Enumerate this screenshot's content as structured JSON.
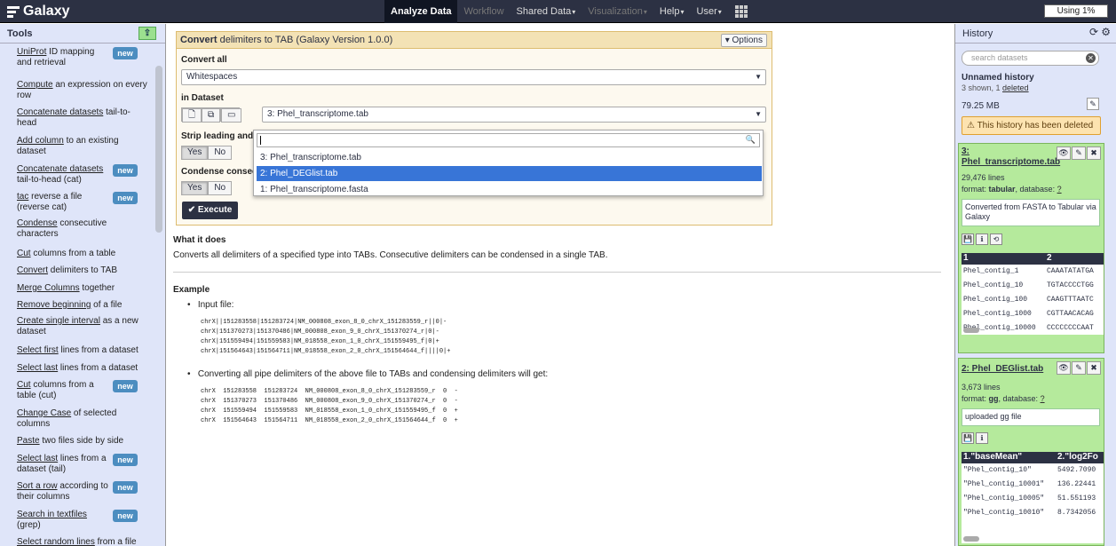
{
  "masthead": {
    "brand": "Galaxy",
    "nav": [
      {
        "label": "Analyze Data",
        "state": "active",
        "caret": ""
      },
      {
        "label": "Workflow",
        "state": "disabled",
        "caret": ""
      },
      {
        "label": "Shared Data",
        "state": "normal",
        "caret": "▾"
      },
      {
        "label": "Visualization",
        "state": "disabled",
        "caret": "▾"
      },
      {
        "label": "Help",
        "state": "normal",
        "caret": "▾"
      },
      {
        "label": "User",
        "state": "normal",
        "caret": "▾"
      }
    ],
    "quota": "Using 1%"
  },
  "tools_panel": {
    "title": "Tools",
    "upload_icon": "upload-icon",
    "tools": [
      {
        "link": "UniProt",
        "rest": " ID mapping and retrieval",
        "new": true
      },
      {
        "link": "Compute",
        "rest": " an expression on every row",
        "new": false
      },
      {
        "link": "Concatenate datasets",
        "rest": " tail-to-head",
        "new": false
      },
      {
        "link": "Add column",
        "rest": " to an existing dataset",
        "new": false
      },
      {
        "link": "Concatenate datasets",
        "rest": " tail-to-head (cat)",
        "new": true
      },
      {
        "link": "tac",
        "rest": " reverse a file (reverse cat)",
        "new": true
      },
      {
        "link": "Condense",
        "rest": " consecutive characters",
        "new": false
      },
      {
        "link": "Cut",
        "rest": " columns from a table",
        "new": false
      },
      {
        "link": "Convert",
        "rest": " delimiters to TAB",
        "new": false
      },
      {
        "link": "Merge Columns",
        "rest": " together",
        "new": false
      },
      {
        "link": "Remove beginning",
        "rest": " of a file",
        "new": false
      },
      {
        "link": "Create single interval",
        "rest": " as a new dataset",
        "new": false
      },
      {
        "link": "Select first",
        "rest": " lines from a dataset",
        "new": false
      },
      {
        "link": "Select last",
        "rest": " lines from a dataset",
        "new": false
      },
      {
        "link": "Cut",
        "rest": " columns from a table (cut)",
        "new": true
      },
      {
        "link": "Change Case",
        "rest": " of selected columns",
        "new": false
      },
      {
        "link": "Paste",
        "rest": " two files side by side",
        "new": false
      },
      {
        "link": "Select last",
        "rest": " lines from a dataset (tail)",
        "new": true
      },
      {
        "link": "Sort a row",
        "rest": " according to their columns",
        "new": true
      },
      {
        "link": "Search in textfiles",
        "rest": " (grep)",
        "new": true
      },
      {
        "link": "Select random lines",
        "rest": " from a file",
        "new": false
      }
    ],
    "new_label": "new"
  },
  "tool_form": {
    "title_bold": "Convert",
    "title_rest": " delimiters to TAB (Galaxy Version 1.0.0)",
    "options_label": "Options",
    "convert_all_label": "Convert all",
    "convert_all_value": "Whitespaces",
    "in_dataset_label": "in Dataset",
    "in_dataset_value": "3: Phel_transcriptome.tab",
    "strip_label": "Strip leading and",
    "condense_label": "Condense consec",
    "yes_label": "Yes",
    "no_label": "No",
    "execute_label": "Execute",
    "dropdown_options": [
      {
        "label": "3: Phel_transcriptome.tab",
        "selected": false
      },
      {
        "label": "2: Phel_DEGlist.tab",
        "selected": true
      },
      {
        "label": "1: Phel_transcriptome.fasta",
        "selected": false
      }
    ]
  },
  "help": {
    "what_heading": "What it does",
    "what_text": "Converts all delimiters of a specified type into TABs. Consecutive delimiters can be condensed in a single TAB.",
    "example_heading": "Example",
    "bullet1": "Input file:",
    "input_lines": [
      "chrX||151283558|151283724|NM_000808_exon_8_0_chrX_151283559_r||0|-",
      "chrX|151370273|151370486|NM_000808_exon_9_0_chrX_151370274_r|0|-",
      "chrX|151559494|151559583|NM_018558_exon_1_0_chrX_151559495_f|0|+",
      "chrX|151564643|151564711|NM_018558_exon_2_0_chrX_151564644_f||||0|+"
    ],
    "bullet2": "Converting all pipe delimiters of the above file to TABs and condensing delimiters will get:",
    "output_lines": [
      "chrX  151283558  151283724  NM_000808_exon_8_0_chrX_151283559_r  0  -",
      "chrX  151370273  151370486  NM_000808_exon_9_0_chrX_151370274_r  0  -",
      "chrX  151559494  151559583  NM_018558_exon_1_0_chrX_151559495_f  0  +",
      "chrX  151564643  151564711  NM_018558_exon_2_0_chrX_151564644_f  0  +"
    ]
  },
  "history": {
    "title": "History",
    "search_placeholder": "search datasets",
    "name": "Unnamed history",
    "counts_prefix": "3 shown, 1 ",
    "counts_link": "deleted",
    "size": "79.25 MB",
    "deleted_warning": "This history has been deleted",
    "datasets": [
      {
        "title": "3: Phel_transcriptome.tab",
        "lines": "29,476 lines",
        "format_label": "format: ",
        "format": "tabular",
        "db_label": ", database: ",
        "db": "?",
        "info": "Converted from FASTA to Tabular via Galaxy",
        "peek_headers": [
          "1",
          "2"
        ],
        "peek_rows": [
          [
            "Phel_contig_1",
            "CAAATATATGA"
          ],
          [
            "Phel_contig_10",
            "TGTACCCCTGG"
          ],
          [
            "Phel_contig_100",
            "CAAGTTTAATC"
          ],
          [
            "Phel_contig_1000",
            "CGTTAACACAG"
          ],
          [
            "Phel_contig_10000",
            "CCCCCCCCAAT"
          ]
        ]
      },
      {
        "title": "2: Phel_DEGlist.tab",
        "lines": "3,673 lines",
        "format_label": "format: ",
        "format": "gg",
        "db_label": ", database: ",
        "db": "?",
        "info": "uploaded gg file",
        "peek_headers": [
          "1.\"baseMean\"",
          "2.\"log2Fo"
        ],
        "peek_rows": [
          [
            "\"Phel_contig_10\"",
            "5492.7090"
          ],
          [
            "\"Phel_contig_10001\"",
            "136.22441"
          ],
          [
            "\"Phel_contig_10005\"",
            "51.551193"
          ],
          [
            "\"Phel_contig_10010\"",
            "8.7342056"
          ]
        ]
      }
    ]
  }
}
